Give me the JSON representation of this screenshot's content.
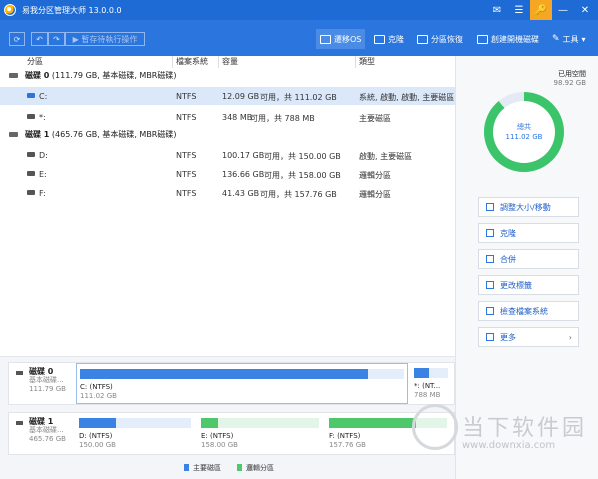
{
  "titlebar": {
    "title": "易我分区管理大师  13.0.0.0",
    "controls": [
      "✉",
      "☰",
      "🔑",
      "—",
      "✕"
    ]
  },
  "toolbar": {
    "refresh": "⟳",
    "undo": "↶",
    "redo": "↷",
    "apply": "▶ 暫存待執行操作",
    "tools": [
      "遷移OS",
      "克隆",
      "分區恢復",
      "創建開機磁碟",
      "工具"
    ]
  },
  "columns": [
    "分區",
    "檔案系統",
    "容量",
    "類型"
  ],
  "disks": [
    {
      "label_bold": "磁碟 0",
      "label_rest": "(111.79 GB, 基本磁碟, MBR磁碟)",
      "partitions": [
        {
          "name": "C:",
          "fs": "NTFS",
          "used": "12.09 GB",
          "cap": "可用，共 111.02 GB",
          "type": "系統, 啟動, 啟動, 主要磁區",
          "selected": true,
          "icon": "windows-drive-icon"
        },
        {
          "name": "*:",
          "fs": "NTFS",
          "used": "348 MB",
          "cap": "可用，共 788 MB",
          "type": "主要磁區",
          "selected": false,
          "icon": "drive-icon"
        }
      ]
    },
    {
      "label_bold": "磁碟 1",
      "label_rest": "(465.76 GB, 基本磁碟, MBR磁碟)",
      "partitions": [
        {
          "name": "D:",
          "fs": "NTFS",
          "used": "100.17 GB",
          "cap": "可用，共 150.00 GB",
          "type": "啟動, 主要磁區",
          "selected": false,
          "icon": "drive-icon"
        },
        {
          "name": "E:",
          "fs": "NTFS",
          "used": "136.66 GB",
          "cap": "可用，共 158.00 GB",
          "type": "邏輯分區",
          "selected": false,
          "icon": "drive-icon"
        },
        {
          "name": "F:",
          "fs": "NTFS",
          "used": "41.43 GB",
          "cap": "可用，共 157.76 GB",
          "type": "邏輯分區",
          "selected": false,
          "icon": "drive-icon"
        }
      ]
    }
  ],
  "side": {
    "used_label": "已用空間",
    "used_value": "98.92 GB",
    "donut_label": "總共",
    "donut_value": "111.02 GB",
    "used_fraction": 0.891,
    "ops": [
      "調整大小/移動",
      "克隆",
      "合併",
      "更改標籤",
      "檢查檔案系統",
      "更多"
    ]
  },
  "map": {
    "disk0": {
      "title": "磁碟 0",
      "sub1": "基本磁碟...",
      "sub2": "111.79 GB",
      "segs": [
        {
          "name": "C: (NTFS)",
          "size": "111.02 GB",
          "fill": 0.89
        },
        {
          "name": "*: (NT...",
          "size": "788 MB",
          "fill": 0.44
        }
      ]
    },
    "disk1": {
      "title": "磁碟 1",
      "sub1": "基本磁碟...",
      "sub2": "465.76 GB",
      "segs": [
        {
          "name": "D: (NTFS)",
          "size": "150.00 GB",
          "fill": 0.33
        },
        {
          "name": "E: (NTFS)",
          "size": "158.00 GB",
          "fill": 0.14
        },
        {
          "name": "F: (NTFS)",
          "size": "157.76 GB",
          "fill": 0.74
        }
      ]
    },
    "legend": [
      "主要磁區",
      "邏輯分區"
    ]
  },
  "watermark": {
    "text": "当下软件园",
    "url": "www.downxia.com"
  },
  "colors": {
    "accent": "#2a75de",
    "primary_partition": "#3a82e4",
    "logical_partition": "#4fc86c"
  }
}
